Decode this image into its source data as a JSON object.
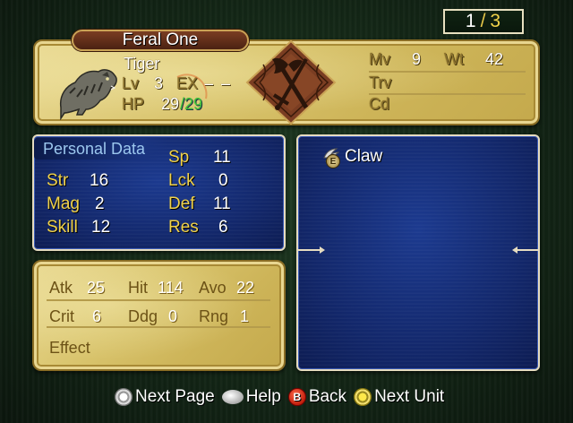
{
  "page": {
    "current": "1",
    "separator": "/",
    "total": "3"
  },
  "unit": {
    "name": "Feral One",
    "class": "Tiger",
    "lv_label": "Lv",
    "lv": "3",
    "ex_label": "EX",
    "ex": "– –",
    "hp_label": "HP",
    "hp_current": "29",
    "hp_max": "/29",
    "portrait_icon": "tiger-portrait-icon"
  },
  "movement": {
    "mv_label": "Mv",
    "mv": "9",
    "wt_label": "Wt",
    "wt": "42",
    "trv_label": "Trv",
    "cd_label": "Cd"
  },
  "emblem_icon": "axe-and-sword-crossed-icon",
  "personal": {
    "title": "Personal Data",
    "stats_left": [
      {
        "label": "Str",
        "value": "16"
      },
      {
        "label": "Mag",
        "value": "2"
      },
      {
        "label": "Skill",
        "value": "12"
      }
    ],
    "stats_right": [
      {
        "label": "Sp",
        "value": "11"
      },
      {
        "label": "Lck",
        "value": "0"
      },
      {
        "label": "Def",
        "value": "11"
      },
      {
        "label": "Res",
        "value": "6"
      }
    ]
  },
  "combat": {
    "atk_label": "Atk",
    "atk": "25",
    "hit_label": "Hit",
    "hit": "114",
    "avo_label": "Avo",
    "avo": "22",
    "crit_label": "Crit",
    "crit": "6",
    "ddg_label": "Ddg",
    "ddg": "0",
    "rng_label": "Rng",
    "rng": "1",
    "effect_label": "Effect"
  },
  "items": [
    {
      "name": "Claw",
      "equipped_badge": "E",
      "icon": "claw-icon"
    }
  ],
  "help_bar": {
    "next_page": "Next Page",
    "help": "Help",
    "back": "Back",
    "back_button": "B",
    "next_unit": "Next Unit"
  },
  "colors": {
    "parchment": "#d9c46d",
    "panel_blue": "#13286c",
    "stat_label_yellow": "#f0d24a",
    "hp_max_green": "#3fc23a",
    "personal_title_blue": "#9cc7ee"
  }
}
